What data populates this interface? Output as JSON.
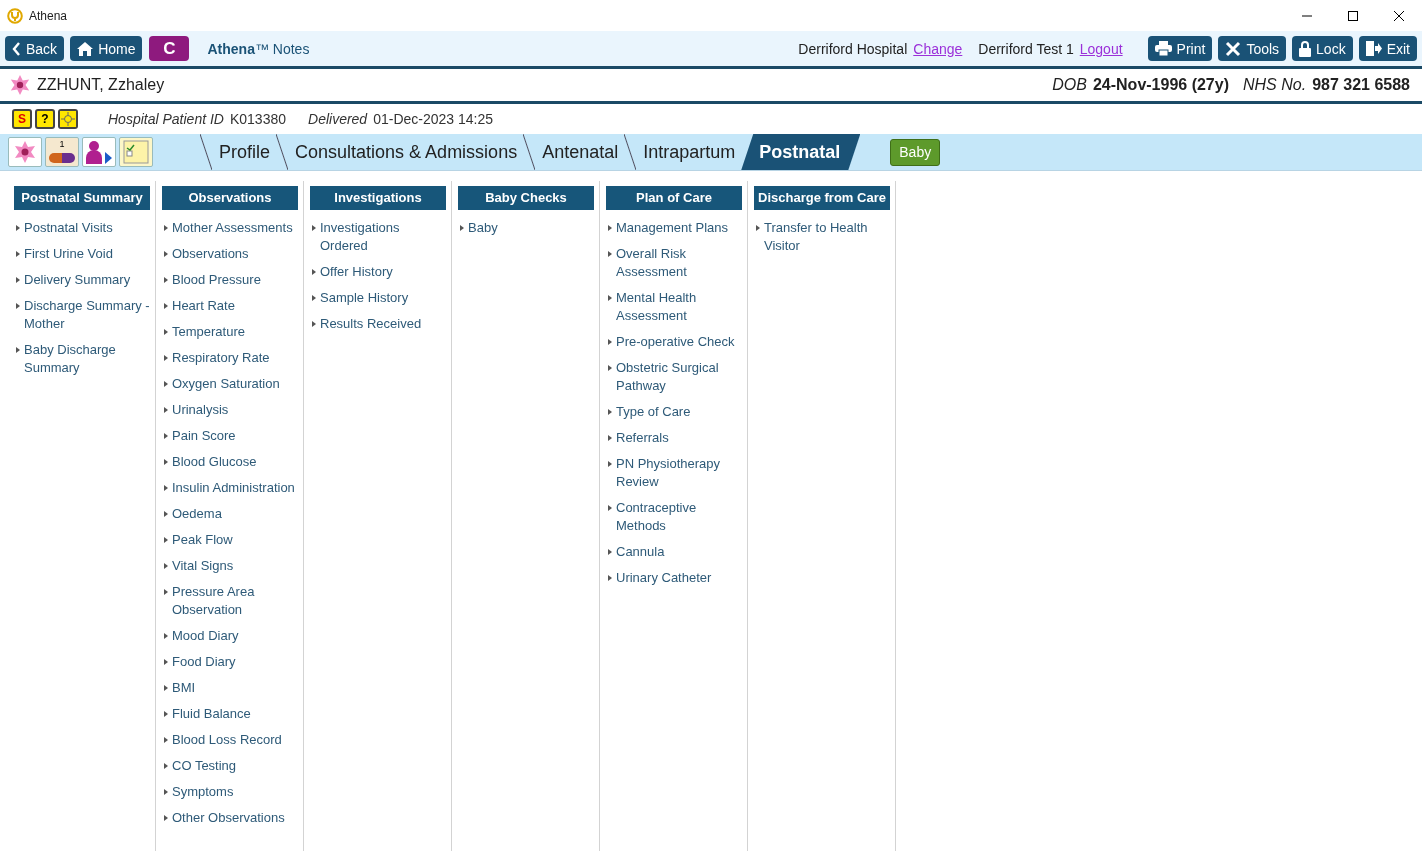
{
  "window": {
    "title": "Athena"
  },
  "toolbar": {
    "nav_buttons": [
      {
        "kind": "back",
        "label": "Back"
      },
      {
        "kind": "home",
        "label": "Home"
      }
    ],
    "c_button": "C",
    "app_name": "**Athena**™ Notes",
    "location": "Derriford Hospital",
    "change_link": "Change",
    "user": "Derriford Test 1",
    "logout_link": "Logout",
    "action_buttons": [
      {
        "kind": "print",
        "label": "Print"
      },
      {
        "kind": "tools",
        "label": "Tools"
      },
      {
        "kind": "lock",
        "label": "Lock"
      },
      {
        "kind": "exit",
        "label": "Exit"
      }
    ]
  },
  "patient": {
    "name": "ZZHUNT, Zzhaley",
    "dob_label": "DOB",
    "dob": "24-Nov-1996 (27y)",
    "nhs_label": "NHS No.",
    "nhs_number": "987 321 6588"
  },
  "info": {
    "alerts": [
      {
        "kind": "s-alert",
        "symbol": "S"
      },
      {
        "kind": "question",
        "symbol": "?"
      },
      {
        "kind": "sun"
      }
    ],
    "hospital_id_label": "Hospital Patient ID",
    "hospital_id": "K013380",
    "delivered_label": "Delivered",
    "delivered": "01-Dec-2023 14:25"
  },
  "quick_icons": [
    {
      "kind": "flower"
    },
    {
      "kind": "medication",
      "count": "1"
    },
    {
      "kind": "person"
    },
    {
      "kind": "notes"
    }
  ],
  "tabs": [
    {
      "label": "Profile",
      "selected": false
    },
    {
      "label": "Consultations & Admissions",
      "selected": false
    },
    {
      "label": "Antenatal",
      "selected": false
    },
    {
      "label": "Intrapartum",
      "selected": false
    },
    {
      "label": "Postnatal",
      "selected": true
    }
  ],
  "baby_button": "Baby",
  "menu_columns": [
    {
      "heading": "Postnatal Summary",
      "items": [
        "Postnatal Visits",
        "First Urine Void",
        "Delivery Summary",
        "Discharge Summary - Mother",
        "Baby Discharge Summary"
      ]
    },
    {
      "heading": "Observations",
      "items": [
        "Mother Assessments",
        "Observations",
        "Blood Pressure",
        "Heart Rate",
        "Temperature",
        "Respiratory Rate",
        "Oxygen Saturation",
        "Urinalysis",
        "Pain Score",
        "Blood Glucose",
        "Insulin Administration",
        "Oedema",
        "Peak Flow",
        "Vital Signs",
        "Pressure Area Observation",
        "Mood Diary",
        "Food Diary",
        "BMI",
        "Fluid Balance",
        "Blood Loss Record",
        "CO Testing",
        "Symptoms",
        "Other Observations"
      ]
    },
    {
      "heading": "Investigations",
      "items": [
        "Investigations Ordered",
        "Offer History",
        "Sample History",
        "Results Received"
      ]
    },
    {
      "heading": "Baby Checks",
      "items": [
        "Baby"
      ]
    },
    {
      "heading": "Plan of Care",
      "items": [
        "Management Plans",
        "Overall Risk Assessment",
        "Mental Health Assessment",
        "Pre-operative Check",
        "Obstetric Surgical Pathway",
        "Type of Care",
        "Referrals",
        "PN Physiotherapy Review",
        "Contraceptive Methods",
        "Cannula",
        "Urinary Catheter"
      ]
    },
    {
      "heading": "Discharge from Care",
      "items": [
        "Transfer to Health Visitor"
      ]
    }
  ]
}
